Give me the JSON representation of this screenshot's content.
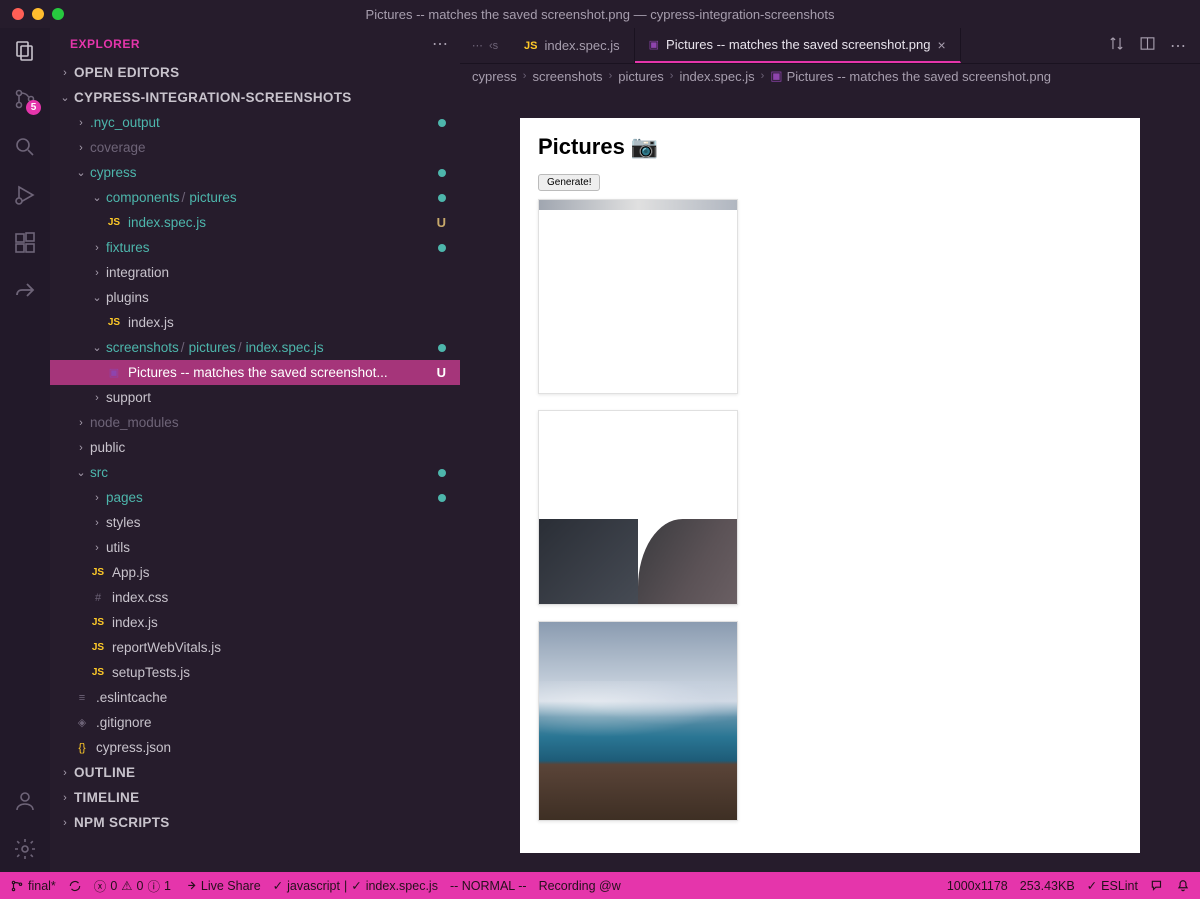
{
  "window_title": "Pictures -- matches the saved screenshot.png — cypress-integration-screenshots",
  "explorer_label": "EXPLORER",
  "sections": {
    "open_editors": "OPEN EDITORS",
    "project": "CYPRESS-INTEGRATION-SCREENSHOTS",
    "outline": "OUTLINE",
    "timeline": "TIMELINE",
    "npm": "NPM SCRIPTS"
  },
  "scm_badge": "5",
  "files": {
    "nyc": ".nyc_output",
    "coverage": "coverage",
    "cypress": "cypress",
    "components": "components",
    "pictures": "pictures",
    "index_spec": "index.spec.js",
    "fixtures": "fixtures",
    "integration": "integration",
    "plugins": "plugins",
    "index_js": "index.js",
    "screenshots": "screenshots",
    "screenshot_png": "Pictures -- matches the saved screenshot...",
    "support": "support",
    "node_modules": "node_modules",
    "public": "public",
    "src": "src",
    "pages": "pages",
    "styles": "styles",
    "utils": "utils",
    "app_js": "App.js",
    "index_css": "index.css",
    "report": "reportWebVitals.js",
    "setup": "setupTests.js",
    "eslintcache": ".eslintcache",
    "gitignore": ".gitignore",
    "cypress_json": "cypress.json"
  },
  "tabs": {
    "overflow": "‹s",
    "spec": "index.spec.js",
    "png": "Pictures -- matches the saved screenshot.png"
  },
  "breadcrumbs": [
    "cypress",
    "screenshots",
    "pictures",
    "index.spec.js",
    "Pictures -- matches the saved screenshot.png"
  ],
  "preview": {
    "heading": "Pictures 📷",
    "button": "Generate!"
  },
  "status": {
    "branch": "final*",
    "errors": "0",
    "warnings": "0",
    "info": "1",
    "live_share": "Live Share",
    "lang": "javascript",
    "spec": "index.spec.js",
    "vim": "-- NORMAL --",
    "recording": "Recording @w",
    "dims": "1000x1178",
    "size": "253.43KB",
    "eslint": "ESLint"
  }
}
